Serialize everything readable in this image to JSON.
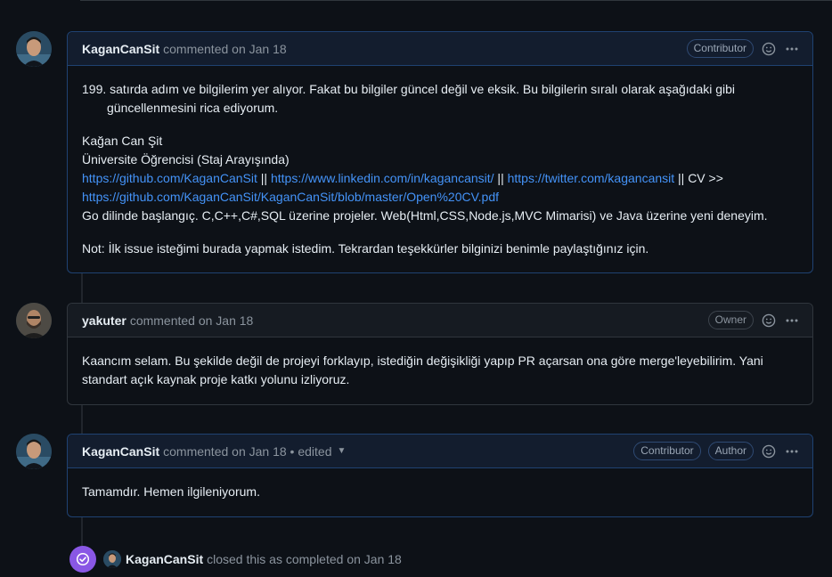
{
  "comments": [
    {
      "author": "KaganCanSit",
      "meta": "commented on Jan 18",
      "badges": [
        "Contributor"
      ],
      "body": {
        "p1_a": "199. satırda adım ve bilgilerim yer alıyor. Fakat bu bilgiler güncel değil ve eksik. Bu bilgilerin sıralı olarak aşağıdaki gibi",
        "p1_b": "güncellenmesini rica ediyorum.",
        "name": "Kağan Can Şit",
        "role": "Üniversite Öğrencisi (Staj Arayışında)",
        "link_github": "https://github.com/KaganCanSit",
        "sep1": " || ",
        "link_linkedin": "https://www.linkedin.com/in/kagancansit/",
        "sep2": " || ",
        "link_twitter": "https://twitter.com/kagancansit",
        "cv_label": " || CV >>",
        "link_cv": "https://github.com/KaganCanSit/KaganCanSit/blob/master/Open%20CV.pdf",
        "skills": "Go dilinde başlangıç. C,C++,C#,SQL üzerine projeler. Web(Html,CSS,Node.js,MVC Mimarisi) ve Java üzerine yeni deneyim.",
        "note": "Not: İlk issue isteğimi burada yapmak istedim. Tekrardan teşekkürler bilginizi benimle paylaştığınız için."
      }
    },
    {
      "author": "yakuter",
      "meta": "commented on Jan 18",
      "badges": [
        "Owner"
      ],
      "body": {
        "l1": "Kaancım selam. Bu şekilde değil de projeyi forklayıp, istediğin değişikliği yapıp PR açarsan ona göre merge'leyebilirim. Yani",
        "l2": "standart açık kaynak proje katkı yolunu izliyoruz."
      }
    },
    {
      "author": "KaganCanSit",
      "meta": "commented on Jan 18 • edited",
      "badges": [
        "Contributor",
        "Author"
      ],
      "body": {
        "l1": "Tamamdır. Hemen ilgileniyorum."
      }
    }
  ],
  "event": {
    "actor": "KaganCanSit",
    "text": "closed this as completed on Jan 18"
  },
  "icons": {
    "reaction": "smiley-icon",
    "menu": "kebab-horizontal-icon",
    "closed": "check-circle-icon"
  },
  "colors": {
    "background": "#0d1117",
    "link": "#4493f8",
    "closed_event": "#8957e5",
    "own_comment_border": "#1f4272"
  }
}
